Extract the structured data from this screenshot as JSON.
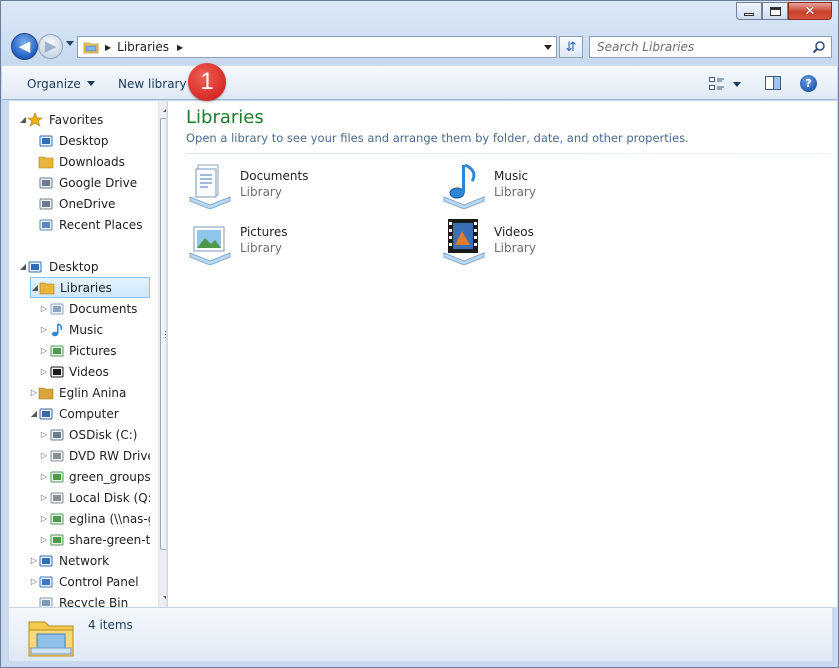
{
  "window": {
    "caption_buttons": [
      "minimize",
      "maximize",
      "close"
    ],
    "close_glyph": "✕"
  },
  "address": {
    "path": [
      "Libraries"
    ],
    "search_placeholder": "Search Libraries"
  },
  "toolbar": {
    "organize_label": "Organize",
    "new_library_label": "New library",
    "help_label": "?"
  },
  "annotation": {
    "badge_number": "1",
    "badge_color": "#d72b23"
  },
  "navigation": {
    "items": [
      {
        "label": "Favorites",
        "icon": "star-icon",
        "expander": "▲",
        "level": 0
      },
      {
        "label": "Desktop",
        "icon": "desktop-icon",
        "expander": "",
        "level": 1
      },
      {
        "label": "Downloads",
        "icon": "downloads-folder-icon",
        "expander": "",
        "level": 1
      },
      {
        "label": "Google Drive",
        "icon": "drive-icon",
        "expander": "",
        "level": 1
      },
      {
        "label": "OneDrive",
        "icon": "drive-icon",
        "expander": "",
        "level": 1
      },
      {
        "label": "Recent Places",
        "icon": "recent-places-icon",
        "expander": "",
        "level": 1
      },
      {
        "label": "Desktop",
        "icon": "desktop-icon",
        "expander": "▲",
        "level": 0
      },
      {
        "label": "Libraries",
        "icon": "libraries-folder-icon",
        "expander": "▲",
        "level": 1,
        "selected": true
      },
      {
        "label": "Documents",
        "icon": "document-icon",
        "expander": "▷",
        "level": 2
      },
      {
        "label": "Music",
        "icon": "music-note-icon",
        "expander": "▷",
        "level": 2
      },
      {
        "label": "Pictures",
        "icon": "picture-icon",
        "expander": "▷",
        "level": 2
      },
      {
        "label": "Videos",
        "icon": "film-icon",
        "expander": "▷",
        "level": 2
      },
      {
        "label": "Eglin  Anina",
        "icon": "user-folder-icon",
        "expander": "▷",
        "level": 1
      },
      {
        "label": "Computer",
        "icon": "computer-icon",
        "expander": "▲",
        "level": 1
      },
      {
        "label": "OSDisk (C:)",
        "icon": "windows-drive-icon",
        "expander": "▷",
        "level": 2
      },
      {
        "label": "DVD RW Drive (",
        "icon": "dvd-drive-icon",
        "expander": "▷",
        "level": 2
      },
      {
        "label": "green_groups_i",
        "icon": "network-drive-icon",
        "expander": "▷",
        "level": 2
      },
      {
        "label": "Local Disk (Q:)",
        "icon": "disk-drive-icon",
        "expander": "▷",
        "level": 2
      },
      {
        "label": "eglina (\\\\nas-g",
        "icon": "network-drive-icon",
        "expander": "▷",
        "level": 2
      },
      {
        "label": "share-green-te",
        "icon": "network-drive-icon",
        "expander": "▷",
        "level": 2
      },
      {
        "label": "Network",
        "icon": "network-icon",
        "expander": "▷",
        "level": 1
      },
      {
        "label": "Control Panel",
        "icon": "control-panel-icon",
        "expander": "▷",
        "level": 1
      },
      {
        "label": "Recycle Bin",
        "icon": "recycle-bin-icon",
        "expander": "",
        "level": 1
      }
    ]
  },
  "content": {
    "title": "Libraries",
    "subtitle": "Open a library to see your files and arrange them by folder, date, and other properties.",
    "title_color": "#1e7b2c",
    "libraries": [
      {
        "name": "Documents",
        "type": "Library",
        "icon": "documents-library-icon"
      },
      {
        "name": "Music",
        "type": "Library",
        "icon": "music-library-icon"
      },
      {
        "name": "Pictures",
        "type": "Library",
        "icon": "pictures-library-icon"
      },
      {
        "name": "Videos",
        "type": "Library",
        "icon": "videos-library-icon"
      }
    ]
  },
  "details": {
    "count": "4 items"
  }
}
